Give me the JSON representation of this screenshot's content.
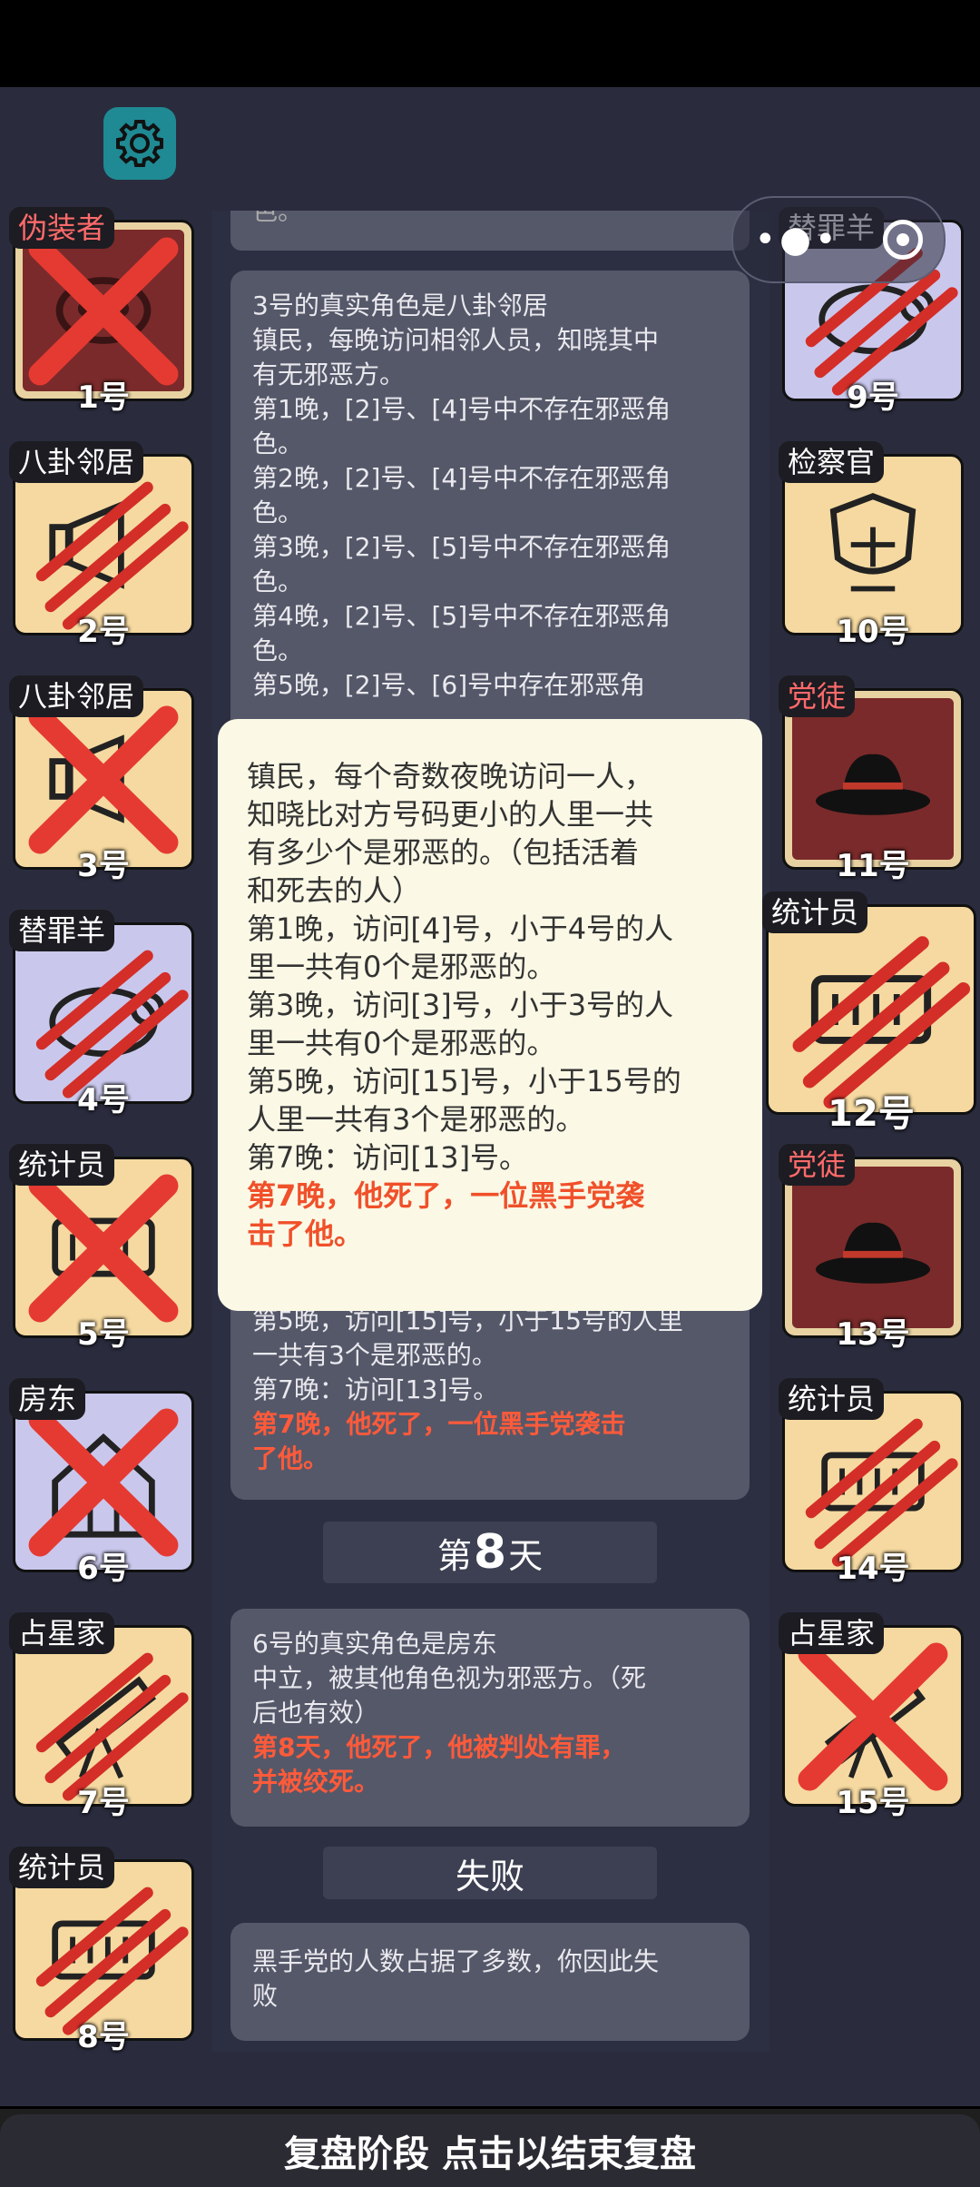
{
  "colors": {
    "dark_red_bg": "#7a2a2a",
    "tan_bg": "#f5d9a0",
    "lavender_bg": "#c9c8ec",
    "red_mark": "#e53a32",
    "gear_bg": "#1f8a93"
  },
  "icons": {
    "settings": "gear-icon",
    "menu": "more-dots-icon",
    "close": "close-circle-icon"
  },
  "cards_left": [
    {
      "role": "伪装者",
      "number": "1号",
      "status": "x",
      "tag_color": "red"
    },
    {
      "role": "八卦邻居",
      "number": "2号",
      "status": "claw"
    },
    {
      "role": "八卦邻居",
      "number": "3号",
      "status": "x"
    },
    {
      "role": "替罪羊",
      "number": "4号",
      "status": "claw"
    },
    {
      "role": "统计员",
      "number": "5号",
      "status": "x"
    },
    {
      "role": "房东",
      "number": "6号",
      "status": "x"
    },
    {
      "role": "占星家",
      "number": "7号",
      "status": "claw"
    },
    {
      "role": "统计员",
      "number": "8号",
      "status": "claw"
    }
  ],
  "cards_right": [
    {
      "role": "替罪羊",
      "number": "9号",
      "status": "claw"
    },
    {
      "role": "检察官",
      "number": "10号",
      "status": "alive"
    },
    {
      "role": "党徒",
      "number": "11号",
      "status": "alive",
      "tag_color": "red"
    },
    {
      "role": "统计员",
      "number": "12号",
      "status": "claw"
    },
    {
      "role": "党徒",
      "number": "13号",
      "status": "alive",
      "tag_color": "red"
    },
    {
      "role": "统计员",
      "number": "14号",
      "status": "claw"
    },
    {
      "role": "占星家",
      "number": "15号",
      "status": "x"
    }
  ],
  "log": {
    "top_fragment": "色。",
    "entry1": [
      "3号的真实角色是八卦邻居",
      "镇民，每晚访问相邻人员，知晓其中",
      "有无邪恶方。",
      "第1晚，[2]号、[4]号中不存在邪恶角",
      "色。",
      "第2晚，[2]号、[4]号中不存在邪恶角",
      "色。",
      "第3晚，[2]号、[5]号中不存在邪恶角",
      "色。",
      "第4晚，[2]号、[5]号中不存在邪恶角",
      "色。",
      "第5晚，[2]号、[6]号中存在邪恶角"
    ],
    "entry2_visible": [
      "第5晚，访问[15]号，小于15号的人里",
      "一共有3个是邪恶的。",
      "第7晚：访问[13]号。"
    ],
    "entry2_red": [
      "第7晚，他死了，一位黑手党袭击",
      "了他。"
    ],
    "day_prefix": "第",
    "day_number": "8",
    "day_suffix": "天",
    "entry3": [
      "6号的真实角色是房东",
      "中立，被其他角色视为邪恶方。（死",
      "后也有效）"
    ],
    "entry3_red": [
      "第8天，他死了，他被判处有罪，",
      "并被绞死。"
    ],
    "result_title": "失败",
    "result_text": [
      "黑手党的人数占据了多数，你因此失",
      "败"
    ]
  },
  "popup": {
    "lines": [
      "镇民，每个奇数夜晚访问一人，",
      "知晓比对方号码更小的人里一共",
      "有多少个是邪恶的。（包括活着",
      "和死去的人）",
      "第1晚，访问[4]号，小于4号的人",
      "里一共有0个是邪恶的。",
      "第3晚，访问[3]号，小于3号的人",
      "里一共有0个是邪恶的。",
      "第5晚，访问[15]号，小于15号的",
      "人里一共有3个是邪恶的。",
      "第7晚：访问[13]号。"
    ],
    "red_lines": [
      "第7晚，他死了，一位黑手党袭",
      "击了他。"
    ]
  },
  "bottom_bar": "复盘阶段 点击以结束复盘"
}
